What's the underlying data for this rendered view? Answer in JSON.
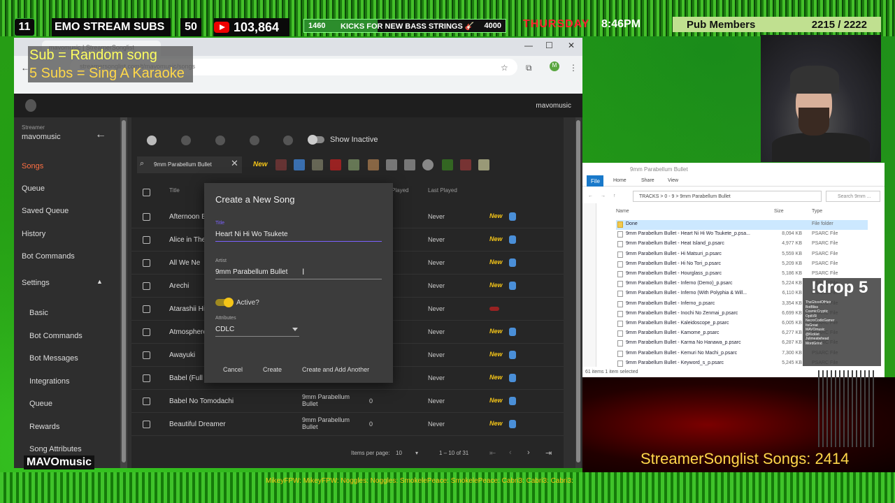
{
  "overlay": {
    "subs_count": "11",
    "subs_label": "EMO STREAM SUBS",
    "subs_goal": "50",
    "yt_count": "103,864",
    "goal_current": "1460",
    "goal_label": "KICKS FOR NEW BASS STRINGS 🎸",
    "goal_target": "4000",
    "goal_progress": 0.365,
    "day": "THURSDAY",
    "time": "8:46PM",
    "pub_label": "Pub Members",
    "pub_count": "2215 / 2222",
    "random_song": "Sub = Random song",
    "karaoke": "5 Subs = Sing A Karaoke",
    "logo": "MAVOmusic",
    "songlist_counter": "StreamerSonglist Songs: 2414",
    "chat": "MikeyFPW:  MikeyFPW:  Noggles:  Noggles:  SmokelePeace:  SmokelePeace:  Cabri3:  Cabri3:  Cabri3:"
  },
  "browser": {
    "tab_title": "mavomusic | StreamerSonglist",
    "url": "streamersonglist.com/t/mavomusic/songs",
    "avatar_letter": "M"
  },
  "app": {
    "header_user": "mavomusic",
    "sidebar": {
      "role": "Streamer",
      "name": "mavomusic",
      "items": [
        "Songs",
        "Queue",
        "Saved Queue",
        "History",
        "Bot Commands",
        "Settings"
      ],
      "sub_items": [
        "Basic",
        "Bot Commands",
        "Bot Messages",
        "Integrations",
        "Queue",
        "Rewards",
        "Song Attributes"
      ]
    },
    "toolbar": {
      "show_inactive": "Show Inactive"
    },
    "search": {
      "value": "9mm Parabellum Bullet",
      "attr_new": "New"
    },
    "columns": {
      "title": "Title",
      "played": "Played",
      "last_played": "Last Played"
    },
    "rows": [
      {
        "title": "Afternoon B",
        "artist": "",
        "plays": "",
        "last": "Never",
        "new": "New"
      },
      {
        "title": "Alice in The",
        "artist": "",
        "plays": "",
        "last": "Never",
        "new": "New"
      },
      {
        "title": "All We Ne",
        "artist": "",
        "plays": "",
        "last": "Never",
        "new": "New"
      },
      {
        "title": "Arechi",
        "artist": "",
        "plays": "",
        "last": "Never",
        "new": "New"
      },
      {
        "title": "Atarashii Hi",
        "artist": "",
        "plays": "",
        "last": "Never",
        "new": ""
      },
      {
        "title": "Atmosphere",
        "artist": "",
        "plays": "",
        "last": "Never",
        "new": "New"
      },
      {
        "title": "Awayuki",
        "artist": "",
        "plays": "",
        "last": "Never",
        "new": "New"
      },
      {
        "title": "Babel (Full A",
        "artist": "Bullet",
        "plays": "",
        "last": "Never",
        "new": "New"
      },
      {
        "title": "Babel No Tomodachi",
        "artist": "9mm Parabellum Bullet",
        "plays": "0",
        "last": "Never",
        "new": "New"
      },
      {
        "title": "Beautiful Dreamer",
        "artist": "9mm Parabellum Bullet",
        "plays": "0",
        "last": "Never",
        "new": "New"
      }
    ],
    "pager": {
      "label": "Items per page:",
      "size": "10",
      "range": "1 – 10 of 31"
    }
  },
  "dialog": {
    "title": "Create a New Song",
    "title_label": "Title",
    "title_value": "Heart Ni Hi Wo Tsukete",
    "artist_label": "Artist",
    "artist_value": "9mm Parabellum Bullet",
    "active_label": "Active?",
    "attributes_label": "Attributes",
    "attributes_value": "CDLC",
    "cancel": "Cancel",
    "create": "Create",
    "create_another": "Create and Add Another"
  },
  "explorer": {
    "title": "9mm Parabellum Bullet",
    "tabs": [
      "File",
      "Home",
      "Share",
      "View"
    ],
    "path": "TRACKS  >  0 - 9  >  9mm Parabellum Bullet",
    "search": "Search 9mm ...",
    "headers": {
      "name": "Name",
      "size": "Size",
      "type": "Type"
    },
    "files": [
      {
        "name": "Done",
        "size": "",
        "type": "File folder",
        "folder": true
      },
      {
        "name": "9mm Parabellum Bullet - Heart Ni Hi Wo Tsukete_p.psa...",
        "size": "8,094 KB",
        "type": "PSARC File"
      },
      {
        "name": "9mm Parabellum Bullet - Heat Island_p.psarc",
        "size": "4,977 KB",
        "type": "PSARC File"
      },
      {
        "name": "9mm Parabellum Bullet - Hi Matsuri_p.psarc",
        "size": "5,559 KB",
        "type": "PSARC File"
      },
      {
        "name": "9mm Parabellum Bullet - Hi No Tori_p.psarc",
        "size": "5,209 KB",
        "type": "PSARC File"
      },
      {
        "name": "9mm Parabellum Bullet - Hourglass_p.psarc",
        "size": "5,186 KB",
        "type": "PSARC File"
      },
      {
        "name": "9mm Parabellum Bullet - Inferno (Demo)_p.psarc",
        "size": "5,224 KB",
        "type": "PSARC File"
      },
      {
        "name": "9mm Parabellum Bullet - Inferno (With Polyphia & Will...",
        "size": "6,110 KB",
        "type": "PSARC File"
      },
      {
        "name": "9mm Parabellum Bullet - Inferno_p.psarc",
        "size": "3,354 KB",
        "type": "PSARC File"
      },
      {
        "name": "9mm Parabellum Bullet - Inochi No Zenmai_p.psarc",
        "size": "6,699 KB",
        "type": "PSARC File"
      },
      {
        "name": "9mm Parabellum Bullet - Kaleidoscope_p.psarc",
        "size": "6,005 KB",
        "type": "PSARC File"
      },
      {
        "name": "9mm Parabellum Bullet - Kamome_p.psarc",
        "size": "6,277 KB",
        "type": "PSARC File"
      },
      {
        "name": "9mm Parabellum Bullet - Karma No Hanawa_p.psarc",
        "size": "6,287 KB",
        "type": "PSARC File"
      },
      {
        "name": "9mm Parabellum Bullet - Kemuri No Machi_p.psarc",
        "size": "7,300 KB",
        "type": "PSARC File"
      },
      {
        "name": "9mm Parabellum Bullet - Keyword_s_p.psarc",
        "size": "5,245 KB",
        "type": "PSARC File"
      }
    ],
    "status": "61 items    1 item selected"
  },
  "drop_panel": {
    "title": "!drop 5",
    "entries": [
      "TheGhostOfHeir",
      "BotBliss",
      "CosmicCryptic",
      "OptiVR",
      "NecroCodicGamer",
      "ItsGreat",
      "MAVOmusic",
      "@Kicklet",
      "Julimeatwhead",
      "MordGrind"
    ]
  },
  "colors": {
    "accent_orange": "#ff7043",
    "new_yellow": "#f5c518",
    "toggle_yellow": "#f5c518",
    "explorer_blue": "#1979ca"
  }
}
